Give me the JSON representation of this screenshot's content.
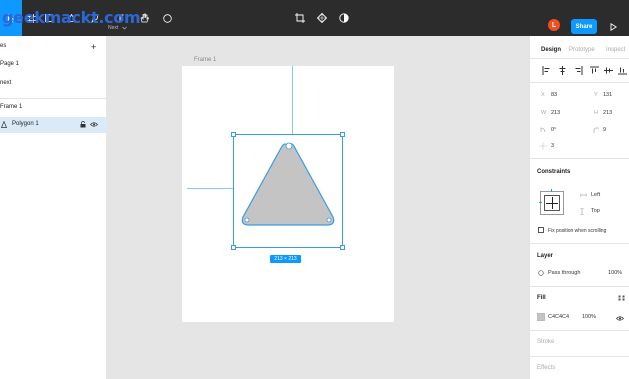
{
  "toolbar": {
    "menu_label": "Next",
    "avatar_initial": "L",
    "share_label": "Share"
  },
  "watermark": "geekmackt.com",
  "left_panel": {
    "pages_header": "es",
    "pages": [
      {
        "label": "Page 1"
      },
      {
        "label": "next"
      }
    ],
    "layers": [
      {
        "label": "Frame 1"
      },
      {
        "label": "Polygon 1"
      }
    ]
  },
  "canvas": {
    "frame_label": "Frame 1",
    "size_label": "213 × 213",
    "polygon_fill": "#c4c4c4",
    "selection_color": "#3a9ce0"
  },
  "right_panel": {
    "tabs": [
      "Design",
      "Prototype",
      "Inspect"
    ],
    "x_label": "X",
    "x_value": "83",
    "y_label": "Y",
    "y_value": "131",
    "w_label": "W",
    "w_value": "213",
    "h_label": "H",
    "h_value": "213",
    "rotation": "0°",
    "corner_radius": "9",
    "count": "3",
    "constraints_title": "Constraints",
    "constraint_h": "Left",
    "constraint_v": "Top",
    "fix_position_label": "Fix position when scrolling",
    "layer_title": "Layer",
    "blend_mode": "Pass through",
    "layer_opacity": "100%",
    "fill_title": "Fill",
    "fill_hex": "C4C4C4",
    "fill_opacity": "100%",
    "fill_color": "#c4c4c4",
    "stroke_title": "Stroke",
    "effects_title": "Effects"
  },
  "colors": {
    "toolbar_bg": "#2c2c2c",
    "accent": "#0d99ff",
    "avatar": "#f24e1e"
  }
}
